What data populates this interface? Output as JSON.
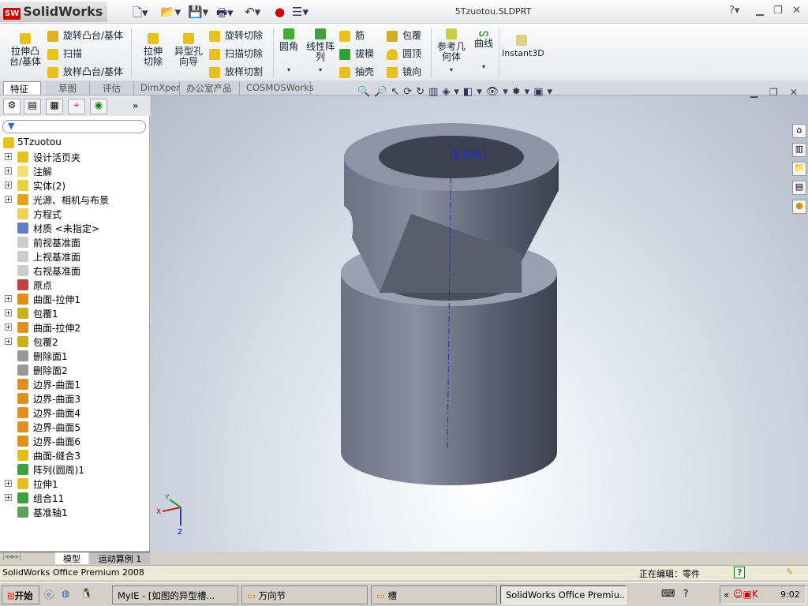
{
  "app": {
    "name": "SolidWorks",
    "doc_title": "5Tzuotou.SLDPRT"
  },
  "quick_access": [
    "new-icon",
    "open-icon",
    "save-icon",
    "print-icon",
    "undo-icon",
    "rebuild-icon",
    "options-icon"
  ],
  "ribbon": {
    "extrude_boss": "拉伸凸台/基体",
    "revolve_boss": "旋转凸台/基体",
    "sweep": "扫描",
    "loft_boss": "放样凸台/基体",
    "extrude_cut": "拉伸切除",
    "hole_wizard": "异型孔向导",
    "revolve_cut": "旋转切除",
    "sweep_cut": "扫描切除",
    "loft_cut": "放样切割",
    "fillet": "圆角",
    "linear_pattern": "线性阵列",
    "rib": "筋",
    "draft": "拔模",
    "shell": "抽壳",
    "wrap": "包覆",
    "dome": "圆顶",
    "mirror": "镜向",
    "ref_geometry": "参考几何体",
    "curves": "曲线",
    "instant3d": "Instant3D"
  },
  "tabs": [
    "特征",
    "草图",
    "评估",
    "DimXpert",
    "办公室产品",
    "COSMOSWorks"
  ],
  "tree": {
    "root": "5Tzuotou",
    "items": [
      {
        "label": "设计活页夹",
        "exp": true,
        "color": "#e8c020"
      },
      {
        "label": "注解",
        "exp": true,
        "color": "#f0e070"
      },
      {
        "label": "实体(2)",
        "exp": true,
        "color": "#e8d040"
      },
      {
        "label": "光源、相机与布景",
        "exp": true,
        "color": "#e0a020"
      },
      {
        "label": "方程式",
        "exp": false,
        "color": "#f0d060"
      },
      {
        "label": "材质 <未指定>",
        "exp": false,
        "color": "#6080c0"
      },
      {
        "label": "前视基准面",
        "exp": false,
        "color": "#ccc"
      },
      {
        "label": "上视基准面",
        "exp": false,
        "color": "#ccc"
      },
      {
        "label": "右视基准面",
        "exp": false,
        "color": "#ccc"
      },
      {
        "label": "原点",
        "exp": false,
        "color": "#c04040"
      },
      {
        "label": "曲面-拉伸1",
        "exp": true,
        "color": "#e09020"
      },
      {
        "label": "包覆1",
        "exp": true,
        "color": "#c8b020"
      },
      {
        "label": "曲面-拉伸2",
        "exp": true,
        "color": "#e09020"
      },
      {
        "label": "包覆2",
        "exp": true,
        "color": "#c8b020"
      },
      {
        "label": "删除面1",
        "exp": false,
        "color": "#999"
      },
      {
        "label": "删除面2",
        "exp": false,
        "color": "#999"
      },
      {
        "label": "边界-曲面1",
        "exp": false,
        "color": "#e09020"
      },
      {
        "label": "边界-曲面3",
        "exp": false,
        "color": "#e09020"
      },
      {
        "label": "边界-曲面4",
        "exp": false,
        "color": "#e09020"
      },
      {
        "label": "边界-曲面5",
        "exp": false,
        "color": "#e09020"
      },
      {
        "label": "边界-曲面6",
        "exp": false,
        "color": "#e09020"
      },
      {
        "label": "曲面-缝合3",
        "exp": false,
        "color": "#e0c020"
      },
      {
        "label": "阵列(圆周)1",
        "exp": false,
        "color": "#40a040"
      },
      {
        "label": "拉伸1",
        "exp": true,
        "color": "#e0c020"
      },
      {
        "label": "组合11",
        "exp": true,
        "color": "#40a040"
      },
      {
        "label": "基准轴1",
        "exp": false,
        "color": "#60a060"
      }
    ]
  },
  "bottom_tabs": [
    "模型",
    "运动算例 1"
  ],
  "viewport": {
    "axis_label": "基准轴1",
    "triad": {
      "x": "X",
      "y": "Y",
      "z": "Z"
    }
  },
  "status": {
    "product": "SolidWorks Office Premium 2008",
    "editing": "正在编辑：零件"
  },
  "taskbar": {
    "start": "开始",
    "items": [
      "MyIE - [如图的异型槽...",
      "万向节",
      "槽",
      "SolidWorks Office Premiu..."
    ],
    "clock": "9:02"
  }
}
